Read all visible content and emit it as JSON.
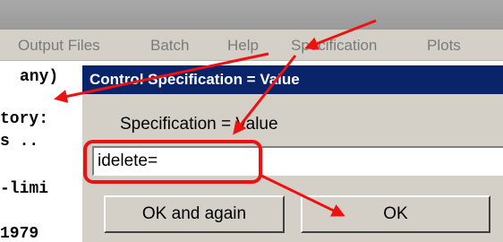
{
  "menubar": {
    "items": [
      {
        "label": "Output Files"
      },
      {
        "label": "Batch"
      },
      {
        "label": "Help"
      },
      {
        "label": "Specification"
      },
      {
        "label": "Plots"
      }
    ]
  },
  "terminal": {
    "lines": [
      "any)",
      "tory:",
      "s ..",
      "-limi",
      "1979"
    ]
  },
  "dialog": {
    "title": "Control Specification = Value",
    "prompt": "Specification = Value",
    "input_value": "idelete=",
    "buttons": {
      "again_label": "OK and again",
      "ok_label": "OK"
    }
  },
  "annotations": {
    "color": "#ee1111"
  }
}
